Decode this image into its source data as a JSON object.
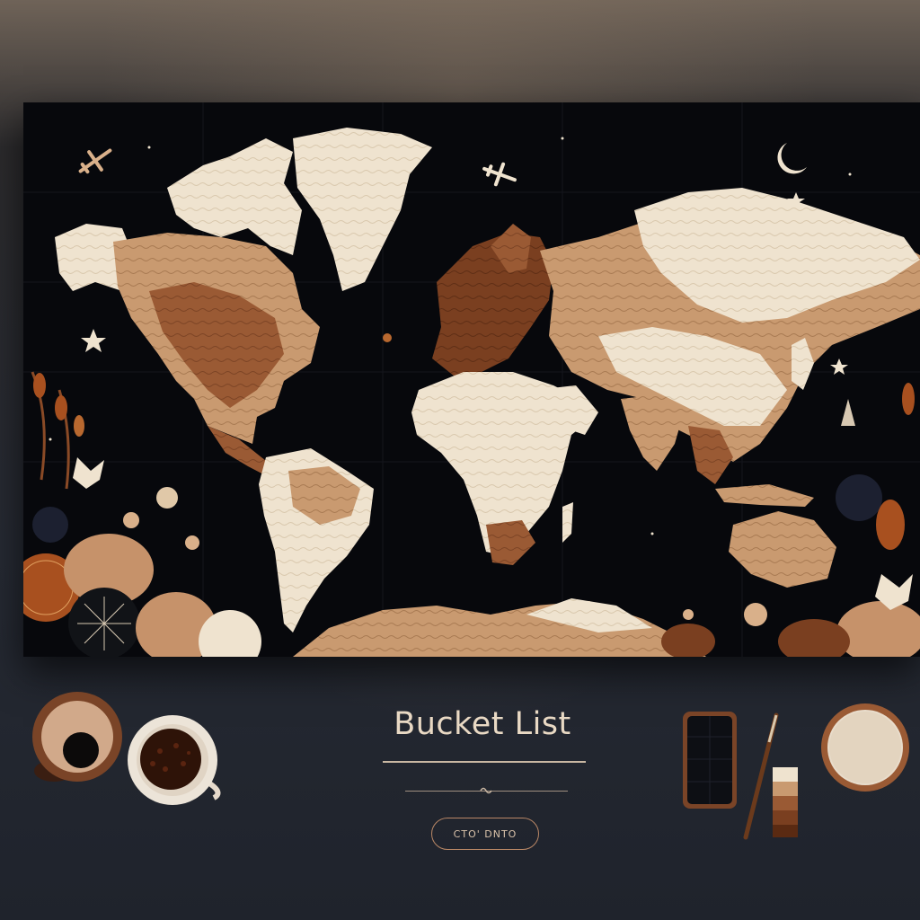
{
  "poster": {
    "title": "Bucket List",
    "cta_label": "CTO' DNTO"
  },
  "palette": {
    "background": "#262a33",
    "map_black": "#07080c",
    "cream": "#efe3cf",
    "tan": "#c99a70",
    "brown": "#9a5a34",
    "dark_brown": "#6e3a1e",
    "accent": "#b98766"
  },
  "icons": [
    "airplane-icon",
    "crescent-moon-icon",
    "star-icon",
    "coffee-cup-icon",
    "smartphone-icon",
    "pen-icon",
    "color-swatch-icon",
    "bowl-icon"
  ]
}
